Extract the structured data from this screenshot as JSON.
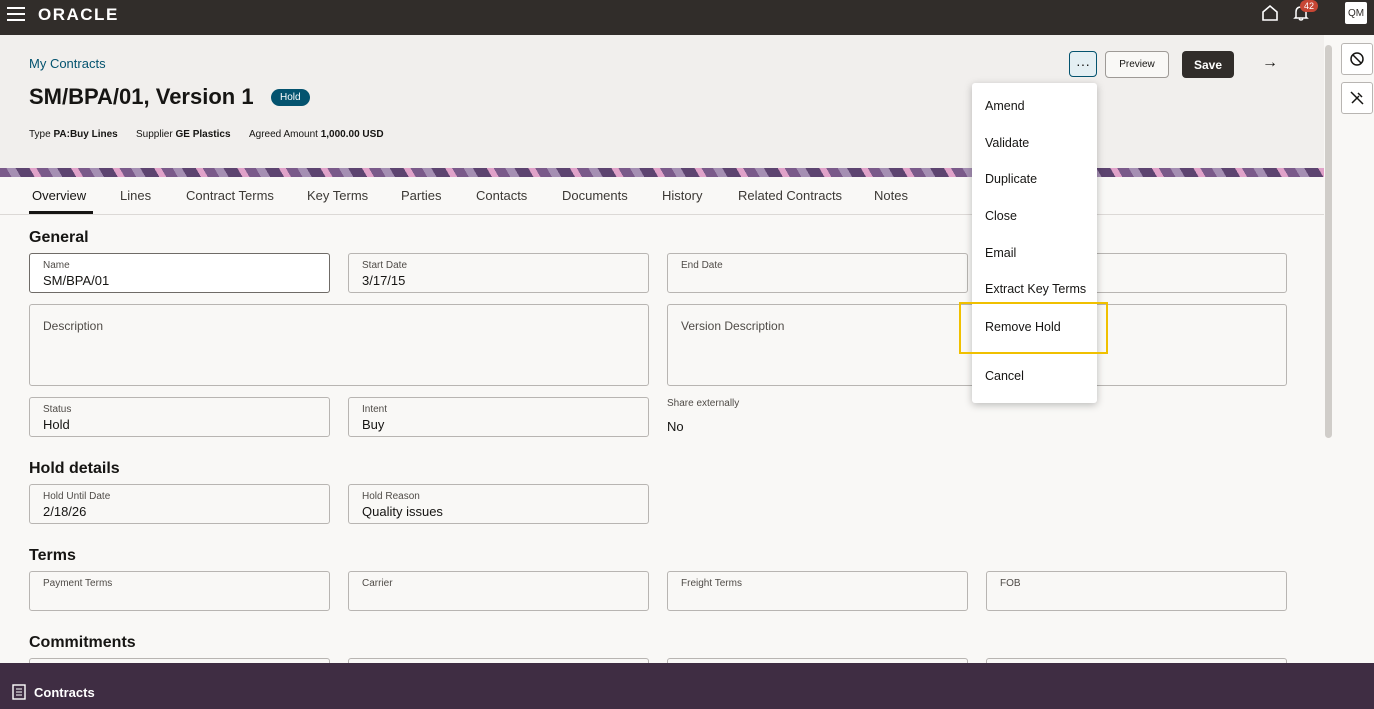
{
  "app": {
    "logo": "ORACLE",
    "notification_count": "42",
    "user_initials": "QM"
  },
  "header": {
    "breadcrumb": "My Contracts",
    "title": "SM/BPA/01, Version 1",
    "status_badge": "Hold",
    "type_label": "Type",
    "type_value": "PA:Buy Lines",
    "supplier_label": "Supplier",
    "supplier_value": "GE Plastics",
    "amount_label": "Agreed Amount",
    "amount_value": "1,000.00 USD",
    "more_label": "···",
    "preview_label": "Preview",
    "save_label": "Save",
    "arrow_label": "→"
  },
  "tabs": [
    "Overview",
    "Lines",
    "Contract Terms",
    "Key Terms",
    "Parties",
    "Contacts",
    "Documents",
    "History",
    "Related Contracts",
    "Notes"
  ],
  "general": {
    "title": "General",
    "name_label": "Name",
    "name_value": "SM/BPA/01",
    "start_label": "Start Date",
    "start_value": "3/17/15",
    "end_label": "End Date",
    "description_label": "Description",
    "version_desc_label": "Version Description",
    "status_label": "Status",
    "status_value": "Hold",
    "intent_label": "Intent",
    "intent_value": "Buy",
    "share_label": "Share externally",
    "share_value": "No"
  },
  "hold": {
    "title": "Hold details",
    "until_label": "Hold Until Date",
    "until_value": "2/18/26",
    "reason_label": "Hold Reason",
    "reason_value": "Quality issues"
  },
  "terms": {
    "title": "Terms",
    "payment_label": "Payment Terms",
    "carrier_label": "Carrier",
    "freight_label": "Freight Terms",
    "fob_label": "FOB"
  },
  "commitments": {
    "title": "Commitments"
  },
  "menu": [
    "Amend",
    "Validate",
    "Duplicate",
    "Close",
    "Email",
    "Extract Key Terms",
    "Remove Hold",
    "Cancel"
  ],
  "bottom": {
    "label": "Contracts"
  },
  "colors": {
    "topbar": "#312d2a",
    "accent": "#04536f",
    "bottombar": "#3f2d43",
    "highlight": "#f0c000"
  }
}
